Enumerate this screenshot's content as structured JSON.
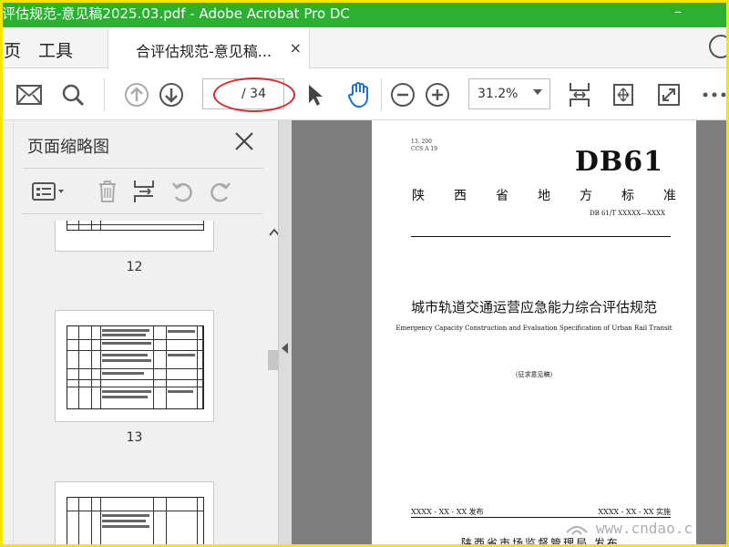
{
  "titlebar": {
    "title": "评估规范-意见稿2025.03.pdf - Adobe Acrobat Pro DC",
    "minimize": "–"
  },
  "tabs": {
    "home_partial": "页",
    "tools": "工具",
    "document": "合评估规范-意见稿...",
    "close": "×"
  },
  "toolbar": {
    "page_total": "/ 34",
    "zoom": "31.2%"
  },
  "thumbnail_panel": {
    "title": "页面缩略图",
    "pages": [
      "12",
      "13"
    ]
  },
  "document": {
    "std_codes": [
      "13. 200",
      "CCS A 19"
    ],
    "db_label": "DB61",
    "province_chars": [
      "陕",
      "西",
      "省",
      "地",
      "方",
      "标",
      "准"
    ],
    "db_number": "DB 61/T XXXXX—XXXX",
    "title_cn": "城市轨道交通运营应急能力综合评估规范",
    "title_en": "Emergency Capacity Construction and Evaluation Specification of Urban Rail Transit",
    "draft_note": "（征求意见稿）",
    "published": "XXXX - XX - XX 发布",
    "implemented": "XXXX - XX - XX 实施",
    "issuer": "陕西省市场监督管理局  发布"
  },
  "watermark": "www.cndao.c",
  "colors": {
    "titlebar": "#2bb032",
    "frame": "#f4e600",
    "highlight_oval": "#e0262b",
    "hand_tool": "#1f6fd1"
  }
}
